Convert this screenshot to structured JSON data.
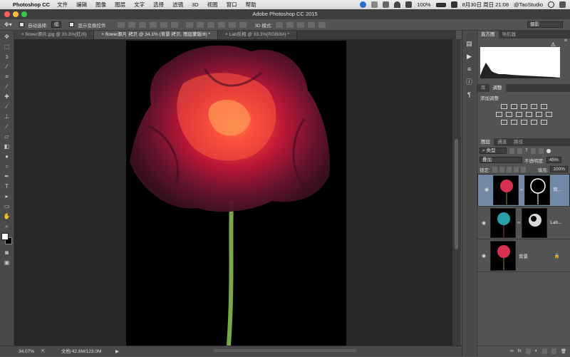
{
  "menubar": {
    "app": "Photoshop CC",
    "items": [
      "文件",
      "编辑",
      "图像",
      "图层",
      "文字",
      "选择",
      "滤镜",
      "3D",
      "视图",
      "窗口",
      "帮助"
    ],
    "battery": "100%",
    "datetime": "8月30日 周日  21:08",
    "user": "@TaoStudio"
  },
  "window": {
    "title": "Adobe Photoshop CC 2015"
  },
  "options": {
    "auto_select_label": "自动选择:",
    "auto_select_value": "组",
    "show_transform_label": "显示变换控件",
    "mode3d_label": "3D 模式:",
    "workspace": "摄影"
  },
  "tabs": [
    "flower原片.jpg @ 33.3%(红/8)",
    "flower原片 拷贝 @ 34.1% (背景 拷贝, 图层蒙版/8) *",
    "Lab反相 @ 33.3%(RGB/8#) *"
  ],
  "status": {
    "zoom": "34.07%",
    "doc": "文档:42.6M/123.0M"
  },
  "histogram": {
    "tabs": [
      "直方图",
      "导航器"
    ]
  },
  "adjustments": {
    "tabs": [
      "库",
      "调整"
    ],
    "title": "添加调整"
  },
  "layers_panel": {
    "tabs": [
      "图层",
      "通道",
      "路径"
    ],
    "kind_label": "类型",
    "blend_mode": "叠加",
    "opacity_label": "不透明度:",
    "opacity_value": "45%",
    "lock_label": "锁定:",
    "fill_label": "填充:",
    "fill_value": "100%",
    "layers": [
      {
        "name": "背...",
        "selected": true
      },
      {
        "name": "Lab...",
        "selected": false
      },
      {
        "name": "背景",
        "selected": false
      }
    ]
  },
  "colors": {
    "accent_selected": "#7388a6",
    "canvas": "#000000"
  }
}
